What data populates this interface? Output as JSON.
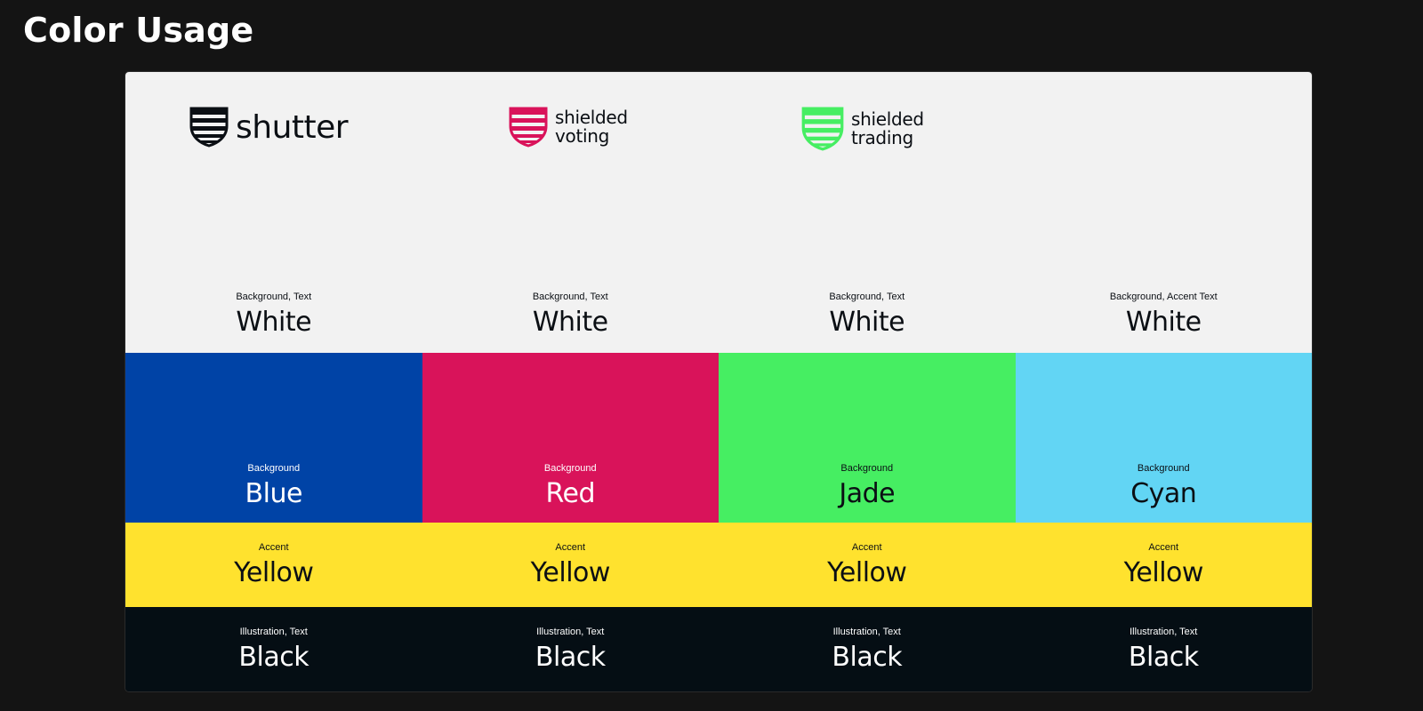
{
  "page": {
    "title": "Color Usage"
  },
  "logos": {
    "shutter": {
      "name": "shutter",
      "icon": "shutter-shield-icon",
      "color": "#0b0f14"
    },
    "voting": {
      "line1": "shielded",
      "line2": "voting",
      "icon": "voting-shield-icon",
      "color": "#d9135a"
    },
    "trading": {
      "line1": "shielded",
      "line2": "trading",
      "icon": "trading-shield-icon",
      "color": "#46ee62"
    }
  },
  "rows": {
    "white": {
      "color": "#f2f2f2",
      "cells": [
        {
          "usage": "Background, Text",
          "name": "White"
        },
        {
          "usage": "Background, Text",
          "name": "White"
        },
        {
          "usage": "Background, Text",
          "name": "White"
        },
        {
          "usage": "Background, Accent Text",
          "name": "White"
        }
      ]
    },
    "brand": {
      "cells": [
        {
          "usage": "Background",
          "name": "Blue",
          "color": "#0043a6"
        },
        {
          "usage": "Background",
          "name": "Red",
          "color": "#d9135a"
        },
        {
          "usage": "Background",
          "name": "Jade",
          "color": "#46ee62"
        },
        {
          "usage": "Background",
          "name": "Cyan",
          "color": "#62d5f4"
        }
      ]
    },
    "yellow": {
      "color": "#ffe22e",
      "cells": [
        {
          "usage": "Accent",
          "name": "Yellow"
        },
        {
          "usage": "Accent",
          "name": "Yellow"
        },
        {
          "usage": "Accent",
          "name": "Yellow"
        },
        {
          "usage": "Accent",
          "name": "Yellow"
        }
      ]
    },
    "black": {
      "color": "#050e14",
      "cells": [
        {
          "usage": "Illustration, Text",
          "name": "Black"
        },
        {
          "usage": "Illustration, Text",
          "name": "Black"
        },
        {
          "usage": "Illustration, Text",
          "name": "Black"
        },
        {
          "usage": "Illustration, Text",
          "name": "Black"
        }
      ]
    }
  }
}
